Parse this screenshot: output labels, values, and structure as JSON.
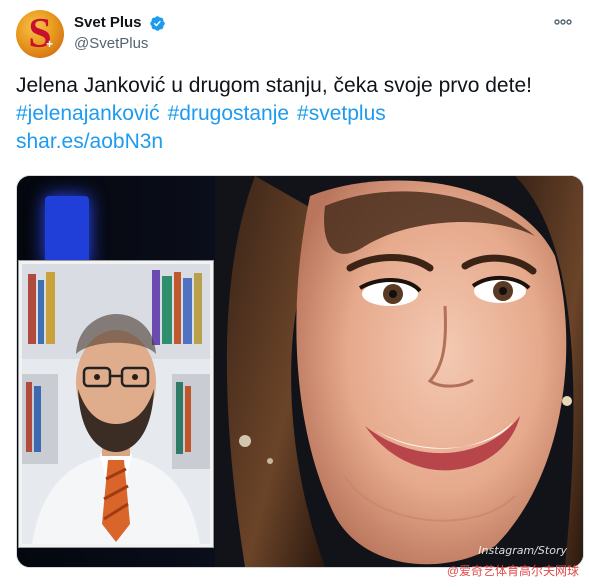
{
  "author": {
    "display_name": "Svet Plus",
    "handle": "@SvetPlus",
    "verified": true,
    "avatar_icon": "svet-plus-logo-icon"
  },
  "more_icon": "more-dots-icon",
  "text": {
    "line1": "Jelena Janković u drugom stanju, čeka svoje prvo dete!",
    "hashtags": [
      "#jelenajanković",
      "#drugostanje",
      "#svetplus"
    ],
    "link": "shar.es/aobN3n"
  },
  "media": {
    "caption": "Instagram/Story"
  },
  "watermark": "@爱奇艺体育高尔夫网球",
  "colors": {
    "accent": "#1d9bf0",
    "text": "#0f1419",
    "muted": "#536471"
  }
}
